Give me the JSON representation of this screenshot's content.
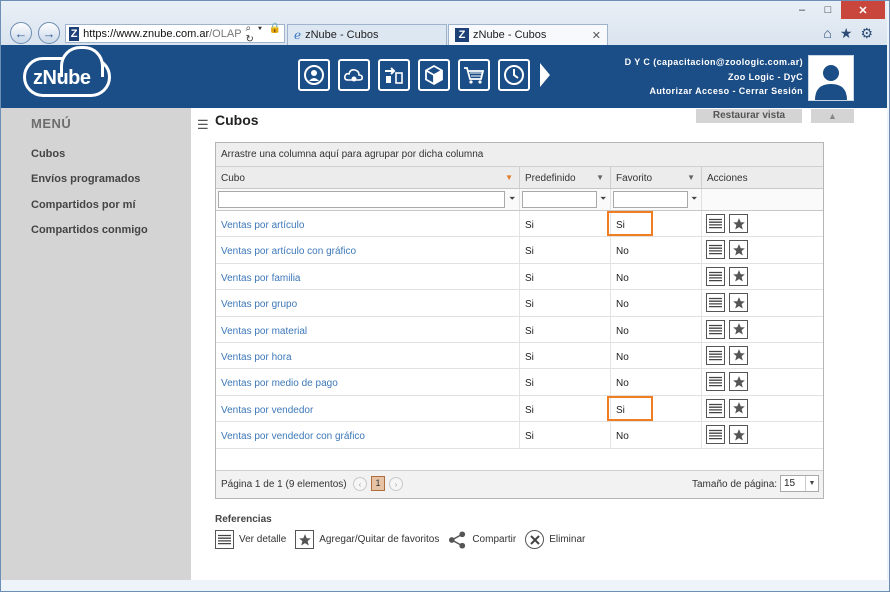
{
  "browser": {
    "url_host": "https://www.znube.com.ar",
    "url_rest": "/OLAP",
    "url_tools": "⌕ ▾ 🔒 ↻",
    "tabs": [
      {
        "title": "zNube - Cubos",
        "active": false
      },
      {
        "title": "zNube - Cubos",
        "active": true
      }
    ],
    "tab_close": "✕",
    "window_controls": [
      "–",
      "□",
      "✕"
    ],
    "chrome_icons": [
      "home-icon",
      "star-icon",
      "gear-icon"
    ]
  },
  "header": {
    "logo_text": "zNube",
    "icons": [
      "sync-user-icon",
      "cloud-settings-icon",
      "transfer-icon",
      "cube-icon",
      "cart-icon",
      "clock-icon",
      "next-arrow-icon"
    ],
    "user_line1": "D Y C (capacitacion@zoologic.com.ar)",
    "user_line2": "Zoo Logic - DyC",
    "authorize": "Autorizar Acceso",
    "separator": "-",
    "logout": "Cerrar Sesión"
  },
  "sidebar": {
    "title": "MENÚ",
    "items": [
      {
        "label": "Cubos"
      },
      {
        "label": "Envíos programados"
      },
      {
        "label": "Compartidos por mí"
      },
      {
        "label": "Compartidos conmigo"
      }
    ]
  },
  "main": {
    "title": "Cubos",
    "restore_button": "Restaurar vista",
    "collapse_button": "▲"
  },
  "grid": {
    "group_panel": "Arrastre una columna aquí para agrupar por dicha columna",
    "columns": [
      "Cubo",
      "Predefinido",
      "Favorito",
      "Acciones"
    ],
    "rows": [
      {
        "cubo": "Ventas por artículo",
        "predefinido": "Si",
        "favorito": "Si",
        "highlighted": true
      },
      {
        "cubo": "Ventas por artículo con gráfico",
        "predefinido": "Si",
        "favorito": "No",
        "highlighted": false
      },
      {
        "cubo": "Ventas por familia",
        "predefinido": "Si",
        "favorito": "No",
        "highlighted": false
      },
      {
        "cubo": "Ventas por grupo",
        "predefinido": "Si",
        "favorito": "No",
        "highlighted": false
      },
      {
        "cubo": "Ventas por material",
        "predefinido": "Si",
        "favorito": "No",
        "highlighted": false
      },
      {
        "cubo": "Ventas por hora",
        "predefinido": "Si",
        "favorito": "No",
        "highlighted": false
      },
      {
        "cubo": "Ventas por medio de pago",
        "predefinido": "Si",
        "favorito": "No",
        "highlighted": false
      },
      {
        "cubo": "Ventas por vendedor",
        "predefinido": "Si",
        "favorito": "Si",
        "highlighted": true
      },
      {
        "cubo": "Ventas por vendedor con gráfico",
        "predefinido": "Si",
        "favorito": "No",
        "highlighted": false
      }
    ],
    "pager": {
      "summary": "Página 1 de 1 (9 elementos)",
      "prev": "‹",
      "current_page": "1",
      "next": "›",
      "page_size_label": "Tamaño de página:",
      "page_size": "15",
      "dropdown": "▼"
    }
  },
  "references": {
    "title": "Referencias",
    "items": [
      {
        "label": "Ver detalle",
        "icon": "list-detail-icon"
      },
      {
        "label": "Agregar/Quitar de favoritos",
        "icon": "star-icon"
      },
      {
        "label": "Compartir",
        "icon": "share-icon"
      },
      {
        "label": "Eliminar",
        "icon": "delete-icon"
      }
    ]
  },
  "colors": {
    "header_bg": "#1b4d86",
    "sidebar_bg": "#d4d4d4",
    "link": "#3d78b8",
    "highlight": "#f07e20"
  }
}
